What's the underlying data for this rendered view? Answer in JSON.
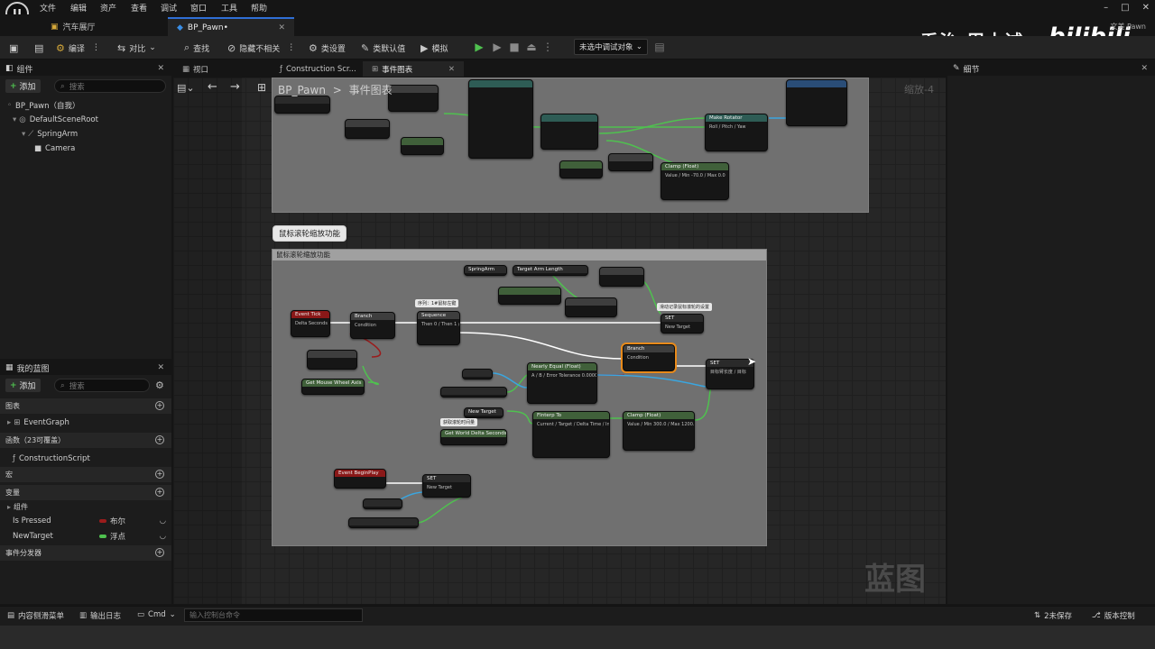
{
  "menu": {
    "logo": "U",
    "items": [
      "文件",
      "编辑",
      "资产",
      "查看",
      "调试",
      "窗口",
      "工具",
      "帮助"
    ]
  },
  "window": {
    "user": "文美  Pawn",
    "minimize": "–",
    "maximize": "□",
    "close": "✕"
  },
  "doc_tabs": [
    {
      "label": "汽车展厅",
      "active": false
    },
    {
      "label": "BP_Pawn•",
      "active": true,
      "close": "✕"
    }
  ],
  "toolbar": {
    "compile": "编译",
    "diff": "对比",
    "find": "查找",
    "hide_unrelated": "隐藏不相关",
    "class_settings": "类设置",
    "class_defaults": "类默认值",
    "simulate": "模拟",
    "debug_target": "未选中调试对象"
  },
  "watermark": {
    "author": "乔治-周士诚",
    "site": "bilibili"
  },
  "components_panel": {
    "title": "组件",
    "add_label": "添加",
    "search_placeholder": "搜索",
    "tree": [
      {
        "label": "BP_Pawn（自我）",
        "indent": 0
      },
      {
        "label": "DefaultSceneRoot",
        "indent": 1
      },
      {
        "label": "SpringArm",
        "indent": 2
      },
      {
        "label": "Camera",
        "indent": 3
      }
    ]
  },
  "my_blueprint": {
    "title": "我的蓝图",
    "add_label": "添加",
    "search_placeholder": "搜索",
    "graphs_header": "图表",
    "event_graph": "EventGraph",
    "functions_header": "函数（23可覆盖）",
    "construction_script": "ConstructionScript",
    "macros_header": "宏",
    "variables_header": "变量",
    "components_sub": "组件",
    "variables": [
      {
        "name": "Is Pressed",
        "type": "布尔",
        "color": "#9b1c1c"
      },
      {
        "name": "NewTarget",
        "type": "浮点",
        "color": "#4fc14f"
      }
    ],
    "dispatchers_header": "事件分发器"
  },
  "graph_tabs": [
    {
      "label": "视口",
      "active": false
    },
    {
      "label": "Construction Scr...",
      "active": false
    },
    {
      "label": "事件图表",
      "active": true,
      "close": "✕"
    }
  ],
  "graph": {
    "breadcrumb_root": "BP_Pawn",
    "breadcrumb_sep": ">",
    "breadcrumb_leaf": "事件图表",
    "zoom": "缩放-4",
    "watermark": "蓝图",
    "comment_bubble": "鼠标滚轮缩放功能",
    "comment_title": "鼠标滚轮缩放功能",
    "mini_bubbles": [
      "序列：1#鼠标左键",
      "滑动记录鼠标滚轮的设置",
      "获取滚轮时间量"
    ],
    "nodes": [
      {
        "key": "event_tick",
        "title": "Event Tick",
        "body": "Delta Seconds"
      },
      {
        "key": "branch_a",
        "title": "Branch",
        "body": "Condition"
      },
      {
        "key": "sequence",
        "title": "Sequence",
        "body": "Then 0 / Then 1 / 添加引脚"
      },
      {
        "key": "set_a",
        "title": "SET",
        "body": "New Target"
      },
      {
        "key": "mouse_wheel",
        "title": "Get Mouse Wheel Axis",
        "body": "Return Value"
      },
      {
        "key": "spring_arm_a",
        "title": "SpringArm",
        "body": ""
      },
      {
        "key": "target_arm_a",
        "title": "Target Arm Length",
        "body": "Target"
      },
      {
        "key": "nearly_equal",
        "title": "Nearly Equal (Float)",
        "body": "A / B / Error Tolerance 0.000001"
      },
      {
        "key": "branch_b",
        "title": "Branch",
        "body": "Condition"
      },
      {
        "key": "set_b",
        "title": "SET",
        "body": "目标臂长度 / 目标"
      },
      {
        "key": "finterp",
        "title": "FInterp To",
        "body": "Current / Target / Delta Time / Interp Speed 5.0"
      },
      {
        "key": "clamp",
        "title": "Clamp (Float)",
        "body": "Value / Min 300.0 / Max 1200.0"
      },
      {
        "key": "world_delta",
        "title": "Get World Delta Seconds",
        "body": "Return Value"
      },
      {
        "key": "begin_play",
        "title": "Event BeginPlay",
        "body": ""
      },
      {
        "key": "set_c",
        "title": "SET",
        "body": "New Target"
      },
      {
        "key": "new_target_get",
        "title": "New Target",
        "body": ""
      },
      {
        "key": "top_rinterp",
        "title": "Make Rotator",
        "body": "Roll / Pitch / Yaw"
      },
      {
        "key": "top_clamp",
        "title": "Clamp (Float)",
        "body": "Value / Min -70.0 / Max 0.0"
      }
    ]
  },
  "details_panel": {
    "title": "细节"
  },
  "statusbar": {
    "content_drawer": "内容侧滑菜单",
    "output_log": "输出日志",
    "cmd": "Cmd",
    "cmd_placeholder": "输入控制台命令",
    "unsaved": "2未保存",
    "source_control": "版本控制"
  },
  "colors": {
    "accent": "#2f6fd6",
    "exec_wire": "#ffffff",
    "float_pin": "#4fc14f",
    "object_pin": "#3aa6e0",
    "bool_pin": "#9b1c1c"
  }
}
